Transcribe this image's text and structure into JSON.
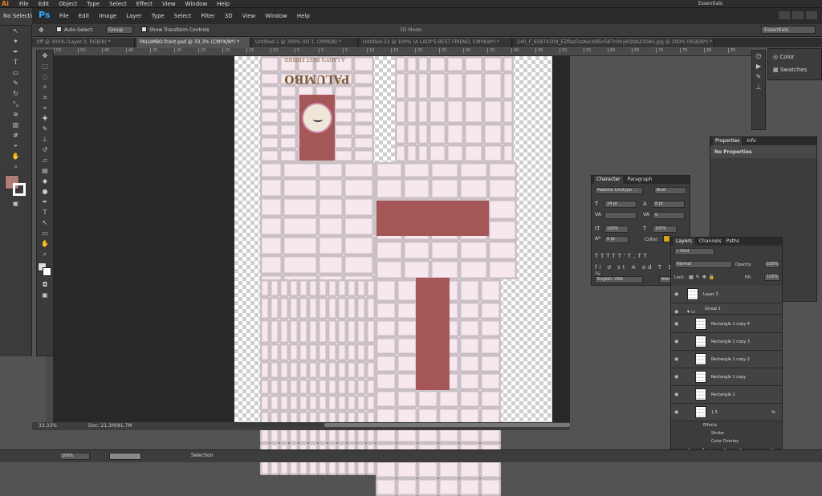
{
  "ai": {
    "logo": "Ai",
    "menu": [
      "File",
      "Edit",
      "Object",
      "Type",
      "Select",
      "Effect",
      "View",
      "Window",
      "Help"
    ],
    "control_label": "No Selection",
    "workspace": "Essentials"
  },
  "ps": {
    "logo": "Ps",
    "menu": [
      "File",
      "Edit",
      "Image",
      "Layer",
      "Type",
      "Select",
      "Filter",
      "3D",
      "View",
      "Window",
      "Help"
    ],
    "options": {
      "auto_select_label": "Auto-Select:",
      "auto_select_value": "Group",
      "show_transform_label": "Show Transform Controls",
      "mode_3d": "3D Mode:",
      "workspace": "Essentials"
    },
    "tabs": [
      ".tiff @ 300% (Layer 0, RGB/8) *",
      "PALUMBO-front.psd @ 33.3% (CMYK/8*) *",
      "Untitled-1 @ 300% (ID 1, CMYK/8) *",
      "Untitled-23 @ 100% (A LADY'S BEST FRIEND, CMYK/8*) *",
      "240_F_65874109_EZfissFszAocXd5n587n0hy6QtAUOOAS.jpg @ 200% (RGB/8*) *"
    ],
    "ruler_ticks": [
      "55",
      "50",
      "45",
      "40",
      "35",
      "30",
      "25",
      "20",
      "15",
      "10",
      "5",
      "0",
      "5",
      "10",
      "15",
      "20",
      "25",
      "30",
      "35",
      "40",
      "45",
      "50",
      "55",
      "60",
      "65",
      "70",
      "75",
      "80",
      "85"
    ],
    "document": {
      "label_flipped": "PALUMBO",
      "tagline_flipped": "A LADY'S BEST FRIEND"
    },
    "status": {
      "zoom": "33.33%",
      "doc": "Doc: 21.3M/81.7M"
    }
  },
  "color_panel": {
    "items": [
      "Color",
      "Swatches"
    ]
  },
  "properties_panel": {
    "tabs": [
      "Properties",
      "Info"
    ],
    "message": "No Properties"
  },
  "character_panel": {
    "tabs": [
      "Character",
      "Paragraph"
    ],
    "font_family": "Palatino Linotype ...",
    "font_style": "Bold",
    "size": "24 pt",
    "leading": "8 pt",
    "kerning": "",
    "tracking": "0",
    "vscale": "100%",
    "hscale": "100%",
    "baseline": "0 pt",
    "color_label": "Color:",
    "swatch_color": "#d4a21f",
    "language": "English: USA",
    "antialias": "Non"
  },
  "layers_panel": {
    "tabs": [
      "Layers",
      "Channels",
      "Paths"
    ],
    "kind": "Kind",
    "blend": "Normal",
    "opacity_label": "Opacity:",
    "opacity": "100%",
    "lock_label": "Lock:",
    "fill_label": "Fill:",
    "fill": "100%",
    "layers": [
      {
        "name": "Layer 3",
        "indent": 0
      },
      {
        "name": "Group 1",
        "indent": 0,
        "group": true
      },
      {
        "name": "Rectangle 1 copy 4",
        "indent": 1
      },
      {
        "name": "Rectangle 1 copy 3",
        "indent": 1
      },
      {
        "name": "Rectangle 1 copy 2",
        "indent": 1
      },
      {
        "name": "Rectangle 1 copy",
        "indent": 1
      },
      {
        "name": "Rectangle 1",
        "indent": 1
      },
      {
        "name": "1.5",
        "indent": 1,
        "fx": "fx"
      }
    ],
    "effects_label": "Effects",
    "effects": [
      "Stroke",
      "Color Overlay"
    ]
  },
  "bottom_bar": {
    "zoom": "100%",
    "tool": "Selection"
  },
  "colors": {
    "accent_red": "#a55656",
    "cell_pink": "#f7e7ef",
    "title_brown": "#7a5a32",
    "fg_swatch": "#b07d78"
  }
}
